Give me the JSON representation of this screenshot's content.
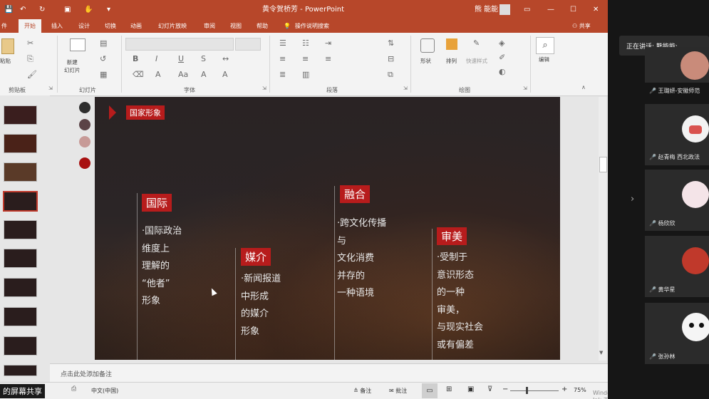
{
  "window": {
    "title": "黄令贺桥芳 - PowerPoint",
    "user": "熊 能能",
    "controls": [
      "↶",
      "↻",
      "☐",
      "✂"
    ]
  },
  "tabs": [
    "件",
    "开始",
    "插入",
    "设计",
    "切换",
    "动画",
    "幻灯片放映",
    "审阅",
    "视图",
    "帮助",
    "操作说明搜索"
  ],
  "share_label": "共享",
  "ribbon": {
    "groups": [
      "剪贴板",
      "幻灯片",
      "字体",
      "段落",
      "绘图",
      "编辑"
    ],
    "paste": "粘贴",
    "new_slide": "新建\n幻灯片",
    "shapes": "形状",
    "arrange": "排列",
    "quick_styles": "快速样式",
    "edit": "编辑"
  },
  "slide": {
    "tag": "国家形象",
    "dot_colors": [
      "#2e2e2e",
      "#5b4347",
      "#c79a97",
      "#a81010"
    ],
    "columns": [
      {
        "label": "国际",
        "lines": [
          "·国际政治",
          "维度上",
          "理解的",
          "“他者”",
          "形象"
        ]
      },
      {
        "label": "媒介",
        "lines": [
          "·新闻报道",
          "中形成",
          "的媒介",
          "形象"
        ]
      },
      {
        "label": "融合",
        "lines": [
          "·跨文化传播",
          "与",
          "文化消费",
          "并存的",
          "一种语境"
        ]
      },
      {
        "label": "审美",
        "lines": [
          "·受制于",
          "意识形态",
          "的一种",
          "审美，",
          "与现实社会",
          "或有偏差"
        ]
      }
    ]
  },
  "notes_placeholder": "点击此处添加备注",
  "status": {
    "language": "中文(中国)",
    "notes": "备注",
    "comments": "批注",
    "zoom": "75%",
    "screen_share": "的屏幕共享",
    "ink": "Windows Ink 工作区"
  },
  "meeting": {
    "speaking": "正在讲话: 熊能能;",
    "participants": [
      "王璐妍-安徽师范",
      "赵青梅 西北政法",
      "杨欣欣",
      "黄华星",
      "张孙林"
    ]
  }
}
